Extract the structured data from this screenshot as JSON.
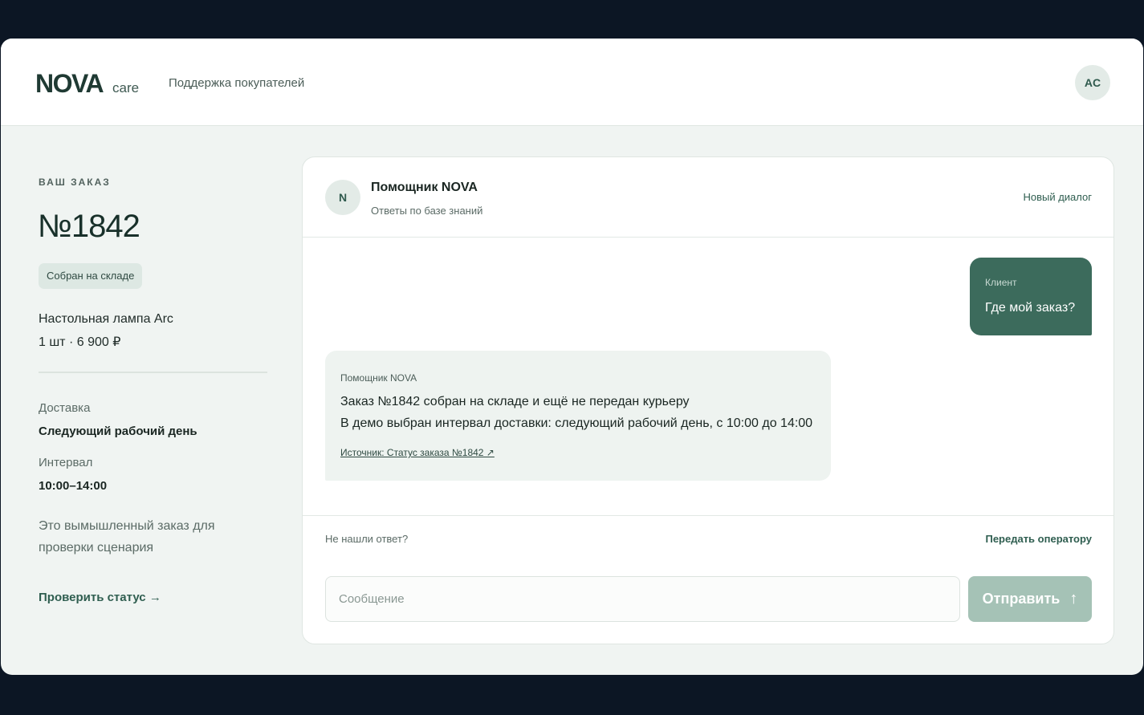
{
  "header": {
    "brand": "NOVA",
    "brand_sub": "care",
    "title": "Поддержка покупателей",
    "avatar_initials": "AC"
  },
  "order": {
    "eyebrow": "ВАШ ЗАКАЗ",
    "number": "№1842",
    "status": "Собран на складе",
    "product_name": "Настольная лампа Arc",
    "product_qty_price": "1 шт · 6 900 ₽",
    "delivery_label": "Доставка",
    "delivery_value": "Следующий рабочий день",
    "interval_label": "Интервал",
    "interval_value": "10:00–14:00",
    "note": "Это вымышленный заказ для проверки сценария",
    "check_status": "Проверить статус →"
  },
  "chat": {
    "bot_avatar": "N",
    "bot_name": "Помощник NOVA",
    "bot_sub": "Ответы по базе знаний",
    "new_dialog": "Новый диалог",
    "messages": [
      {
        "author": "Клиент",
        "text": "Где мой заказ?"
      },
      {
        "author": "Помощник NOVA",
        "line1": "Заказ №1842 собран на складе и ещё не передан курьеру",
        "line2": "В демо выбран интервал доставки: следующий рабочий день, с 10:00 до 14:00",
        "source": "Источник: Статус заказа №1842 ↗"
      }
    ],
    "no_answer": "Не нашли ответ?",
    "handoff": "Передать оператору",
    "input_placeholder": "Сообщение",
    "input_value": "",
    "send_label": "Отправить",
    "send_icon": "↑"
  },
  "colors": {
    "accent": "#3c6b5c",
    "send_disabled": "#a5c2b6",
    "background": "#f0f4f2"
  }
}
